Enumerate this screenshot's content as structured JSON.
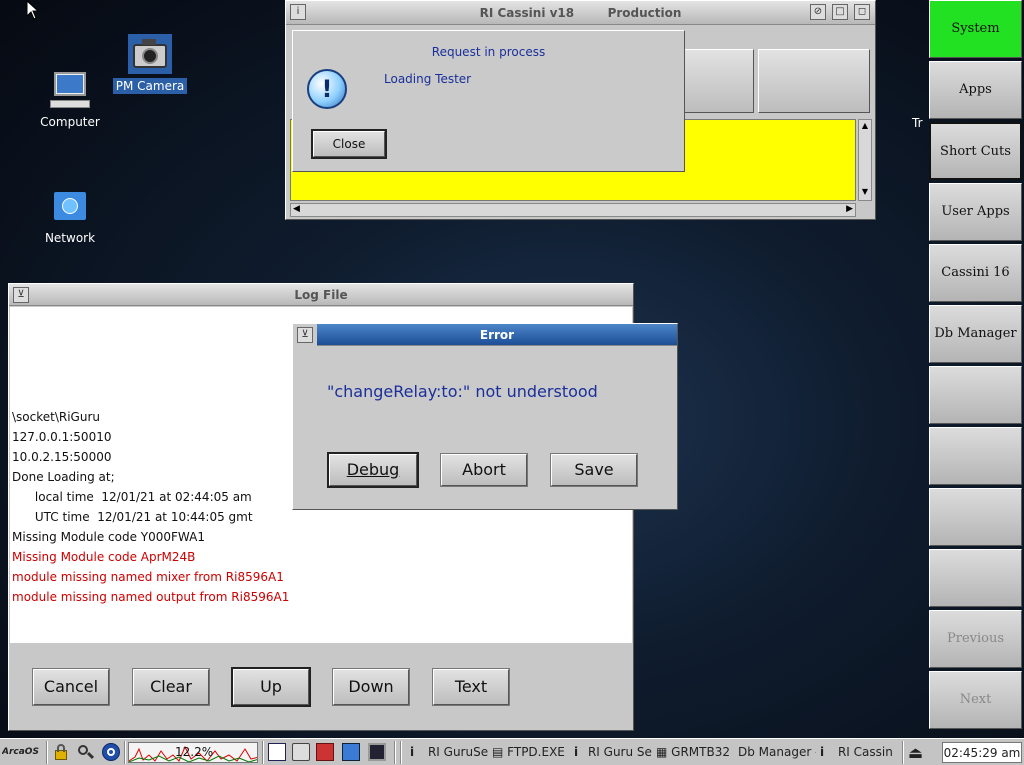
{
  "desktop": {
    "icons": [
      {
        "label": "Computer",
        "icon": "computer-icon"
      },
      {
        "label": "PM Camera",
        "icon": "camera-icon"
      },
      {
        "label": "Network",
        "icon": "network-folder-icon"
      }
    ],
    "partial_label": "Tr"
  },
  "cassini_window": {
    "title": "RI Cassini v18",
    "subtitle": "Production",
    "field_color": "#ffff00"
  },
  "request_dialog": {
    "heading": "Request in process",
    "message": "Loading Tester",
    "close_label": "Close",
    "icon": "info-icon"
  },
  "log_window": {
    "title": "Log File",
    "lines": [
      {
        "text": "\\socket\\RiGuru",
        "color": "normal"
      },
      {
        "text": "127.0.0.1:50010",
        "color": "normal"
      },
      {
        "text": "10.0.2.15:50000",
        "color": "normal"
      },
      {
        "text": "Done Loading at;",
        "color": "normal"
      },
      {
        "text": "      local time  12/01/21 at 02:44:05 am",
        "color": "normal"
      },
      {
        "text": "      UTC time  12/01/21 at 10:44:05 gmt",
        "color": "normal"
      },
      {
        "text": "Missing Module code Y000FWA1",
        "color": "normal"
      },
      {
        "text": "Missing Module code AprM24B",
        "color": "red"
      },
      {
        "text": "module missing named mixer from Ri8596A1",
        "color": "red"
      },
      {
        "text": "module missing named output from Ri8596A1",
        "color": "red"
      }
    ],
    "buttons": {
      "cancel": "Cancel",
      "clear": "Clear",
      "up": "Up",
      "down": "Down",
      "text": "Text"
    }
  },
  "error_dialog": {
    "title": "Error",
    "message": "\"changeRelay:to:\" not understood",
    "buttons": {
      "debug": "Debug",
      "abort": "Abort",
      "save": "Save"
    }
  },
  "right_panel": {
    "items": [
      "System",
      "Apps",
      "Short Cuts",
      "User Apps",
      "Cassini 16",
      "Db Manager",
      "",
      "",
      "",
      "",
      "Previous",
      "Next"
    ],
    "active_color": "#22e022"
  },
  "taskbar": {
    "start_label": "ArcaOS",
    "cpu_label": "12.2%",
    "tasks": [
      "RI GuruSe",
      "FTPD.EXE",
      "RI Guru Se",
      "GRMTB32",
      "Db Manager -",
      "RI Cassin"
    ],
    "clock": "02:45:29 am"
  }
}
